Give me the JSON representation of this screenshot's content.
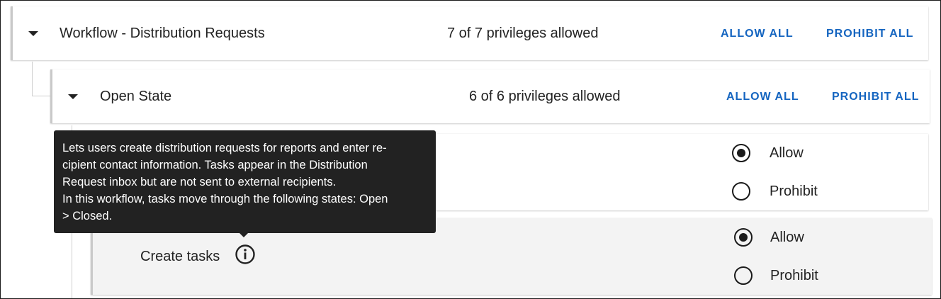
{
  "workflow": {
    "title": "Workflow - Distribution Requests",
    "count": "7 of 7 privileges allowed",
    "allow_all": "ALLOW ALL",
    "prohibit_all": "PROHIBIT ALL"
  },
  "state": {
    "title": "Open State",
    "count": "6 of 6 privileges allowed",
    "allow_all": "ALLOW ALL",
    "prohibit_all": "PROHIBIT ALL"
  },
  "privilege_1": {
    "allow_label": "Allow",
    "prohibit_label": "Prohibit",
    "selected": "Allow"
  },
  "privilege_2": {
    "name": "Create tasks",
    "allow_label": "Allow",
    "prohibit_label": "Prohibit",
    "selected": "Allow"
  },
  "tooltip": {
    "line1": "Lets users create distribution requests for reports and enter re-",
    "line2": "cipient contact information. Tasks appear in the Distribution",
    "line3": "Request inbox but are not sent to external recipients.",
    "line4": "In this workflow, tasks move through the following states: Open",
    "line5": "> Closed."
  },
  "icons": {
    "expand": "caret-down-icon",
    "info": "info-icon"
  }
}
